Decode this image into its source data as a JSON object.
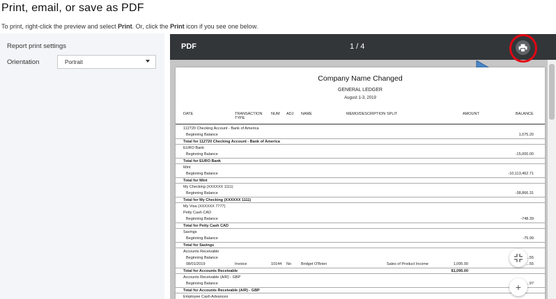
{
  "page": {
    "title": "Print, email, or save as PDF",
    "instruction_prefix": "To print, right-click the preview and select ",
    "instruction_bold_1": "Print",
    "instruction_mid": ". Or, click the ",
    "instruction_bold_2": "Print",
    "instruction_suffix": " icon if you see one below."
  },
  "settings": {
    "title": "Report print settings",
    "orientation_label": "Orientation",
    "orientation_value": "Portrait"
  },
  "viewer": {
    "label": "PDF",
    "page_indicator": "1 / 4",
    "print_icon": "printer-icon",
    "highlight_color": "#e20613",
    "arrow_color": "#4a86c8"
  },
  "report": {
    "company": "Company Name Changed",
    "name": "GENERAL LEDGER",
    "date": "August 1-3, 2019",
    "columns": {
      "date": "DATE",
      "type_line1": "TRANSACTION",
      "type_line2": "TYPE",
      "num": "NUM",
      "adj": "ADJ",
      "name": "NAME",
      "memo": "MEMO/DESCRIPTION",
      "split": "SPLIT",
      "amount": "AMOUNT",
      "balance": "BALANCE"
    },
    "rows": [
      {
        "kind": "acct",
        "date": "112720 Checking Account - Bank of America"
      },
      {
        "kind": "beg",
        "date": "Beginning Balance",
        "balance": "1,075.20"
      },
      {
        "kind": "total",
        "date": "Total for 112720 Checking Account - Bank of America"
      },
      {
        "kind": "acct",
        "date": "EURO Bank"
      },
      {
        "kind": "beg",
        "date": "Beginning Balance",
        "balance": "-15,000.00"
      },
      {
        "kind": "total",
        "date": "Total for EURO Bank"
      },
      {
        "kind": "acct",
        "date": "Mint"
      },
      {
        "kind": "beg",
        "date": "Beginning Balance",
        "balance": "-10,113,462.71"
      },
      {
        "kind": "total",
        "date": "Total for Mint"
      },
      {
        "kind": "acct",
        "date": "My Checking (XXXXXX 1111)"
      },
      {
        "kind": "beg",
        "date": "Beginning Balance",
        "balance": "-38,866.31"
      },
      {
        "kind": "total",
        "date": "Total for My Checking (XXXXXX 1111)"
      },
      {
        "kind": "acct",
        "date": "My Visa (XXXXXX 7777)"
      },
      {
        "kind": "acct",
        "date": "Petty Cash CAD"
      },
      {
        "kind": "beg",
        "date": "Beginning Balance",
        "balance": "-748.39"
      },
      {
        "kind": "total",
        "date": "Total for Petty Cash CAD"
      },
      {
        "kind": "acct",
        "date": "Savings"
      },
      {
        "kind": "beg",
        "date": "Beginning Balance",
        "balance": "-75.99"
      },
      {
        "kind": "total",
        "date": "Total for Savings"
      },
      {
        "kind": "acct",
        "date": "Accounts Receivable"
      },
      {
        "kind": "beg",
        "date": "Beginning Balance",
        "balance": "...55"
      },
      {
        "kind": "beg",
        "date": "08/01/2019",
        "type": "Invoice",
        "num": "10144",
        "adj": "No",
        "name": "Bridget O'Brien",
        "split": "Sales of Product Income",
        "amount": "1,095.00",
        "balance": "...55"
      },
      {
        "kind": "total",
        "date": "Total for Accounts Receivable",
        "amount": "$1,095.00"
      },
      {
        "kind": "acct",
        "date": "Accounts Receivable (A/R) - GBP"
      },
      {
        "kind": "beg",
        "date": "Beginning Balance",
        "balance": "...97"
      },
      {
        "kind": "total",
        "date": "Total for Accounts Receivable (A/R) - GBP"
      },
      {
        "kind": "acct",
        "date": "Employee Cash Advances"
      }
    ]
  },
  "controls": {
    "fit_icon": "fit-page-icon",
    "zoom_icon": "zoom-in-icon",
    "zoom_glyph": "+"
  }
}
